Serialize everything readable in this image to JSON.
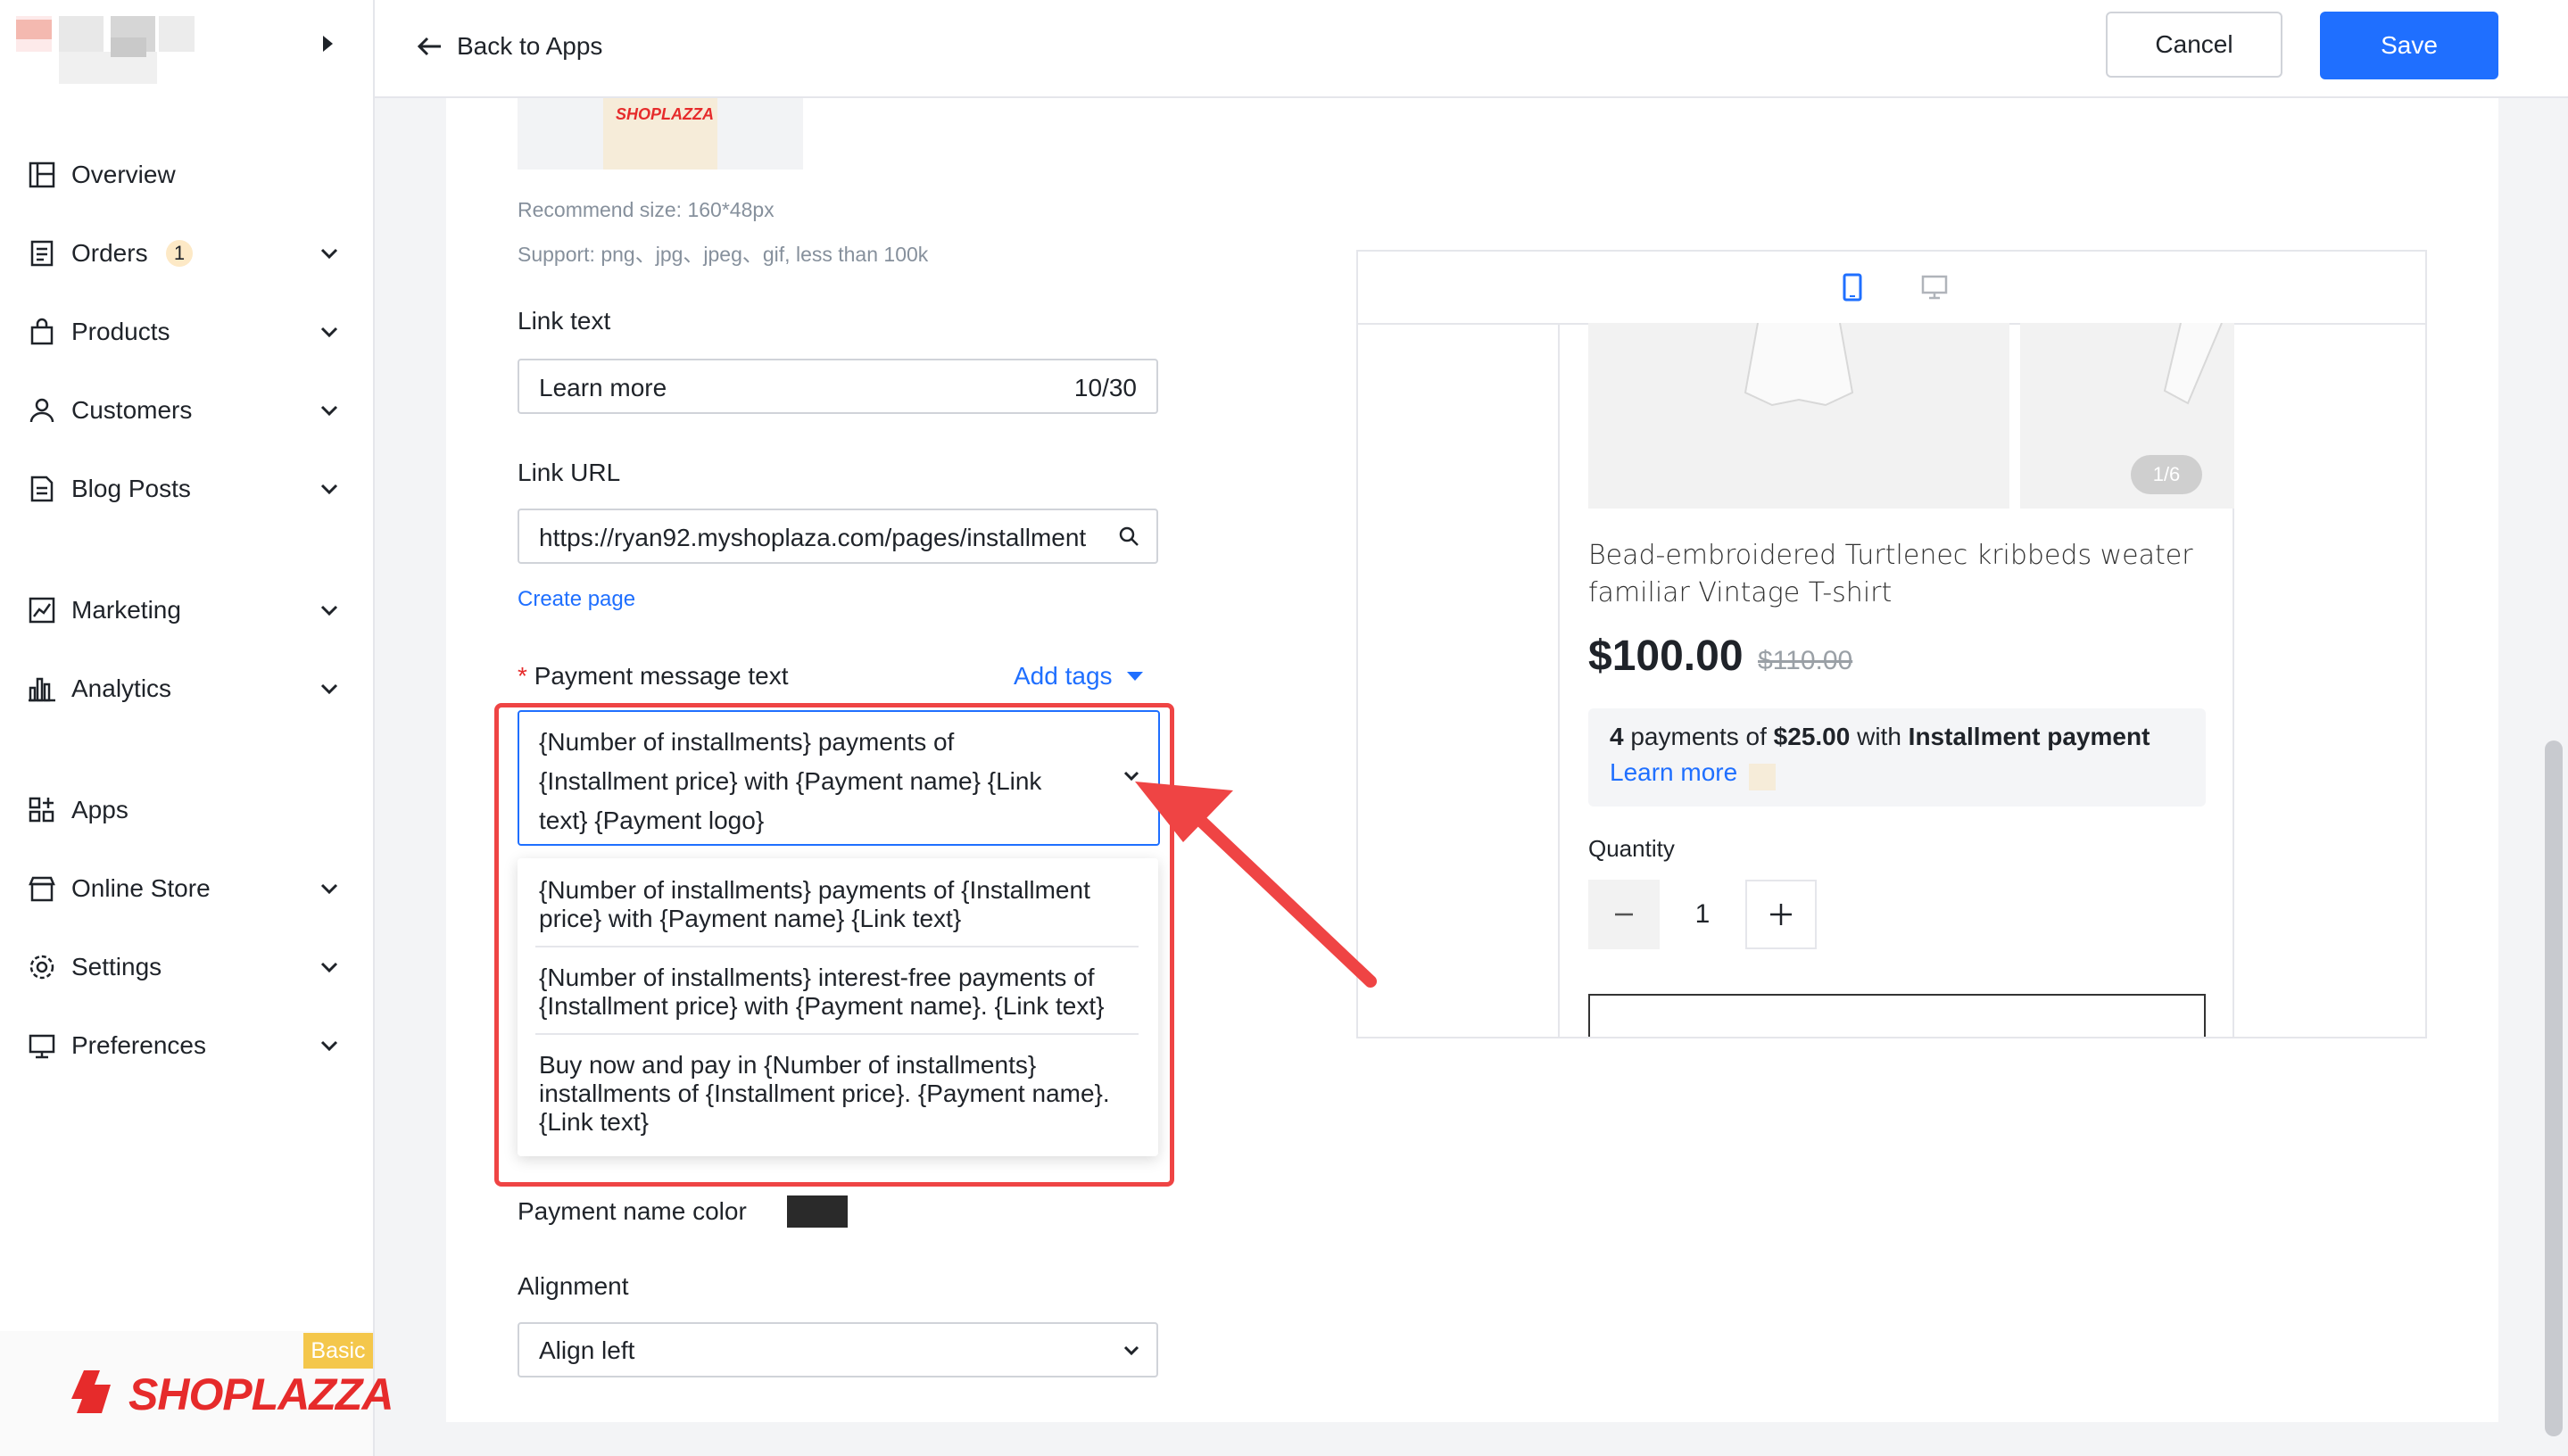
{
  "sidebar": {
    "nav": [
      {
        "label": "Overview",
        "icon": "overview-icon"
      },
      {
        "label": "Orders",
        "icon": "orders-icon",
        "badge": "1"
      },
      {
        "label": "Products",
        "icon": "products-icon"
      },
      {
        "label": "Customers",
        "icon": "customers-icon"
      },
      {
        "label": "Blog Posts",
        "icon": "blog-posts-icon"
      },
      {
        "label": "Marketing",
        "icon": "marketing-icon"
      },
      {
        "label": "Analytics",
        "icon": "analytics-icon"
      },
      {
        "label": "Apps",
        "icon": "apps-icon"
      },
      {
        "label": "Online Store",
        "icon": "online-store-icon"
      },
      {
        "label": "Settings",
        "icon": "settings-icon"
      },
      {
        "label": "Preferences",
        "icon": "preferences-icon"
      }
    ],
    "plan_badge": "Basic",
    "brand": "SHOPLAZZA"
  },
  "header": {
    "back_label": "Back to Apps",
    "cancel_label": "Cancel",
    "save_label": "Save"
  },
  "form": {
    "logo_preview_text": "SHOPLAZZA",
    "recommend_size": "Recommend size: 160*48px",
    "support": "Support: png、jpg、jpeg、gif, less than 100k",
    "link_text_label": "Link text",
    "link_text_value": "Learn more",
    "link_text_count": "10/30",
    "link_url_label": "Link URL",
    "link_url_value": "https://ryan92.myshoplaza.com/pages/installment",
    "create_page": "Create page",
    "payment_message_required": "*",
    "payment_message_label": "Payment message text",
    "add_tags": "Add tags",
    "payment_message_value": "{Number of installments} payments of {Installment price} with {Payment name} {Link text} {Payment logo}",
    "options": [
      "{Number of installments} payments of {Installment price} with {Payment name} {Link text}",
      "{Number of installments} interest-free payments of {Installment price} with {Payment name}. {Link text}",
      "Buy now and pay in {Number of installments} installments of {Installment price}. {Payment name}. {Link text}"
    ],
    "payment_name_color_label": "Payment name color",
    "payment_name_color": "#2a2a2a",
    "alignment_label": "Alignment",
    "alignment_value": "Align left"
  },
  "preview": {
    "image_counter": "1/6",
    "product_title": "Bead-embroidered Turtlenec kribbeds weater familiar Vintage T-shirt",
    "price": "$100.00",
    "compare_price": "$110.00",
    "installment": {
      "count": "4",
      "text_payments_of": "payments of",
      "amount": "$25.00",
      "text_with": "with",
      "payment_name": "Installment payment",
      "learn_more": "Learn more"
    },
    "quantity_label": "Quantity",
    "quantity_value": "1"
  },
  "colors": {
    "accent": "#1f6fff",
    "highlight": "#ef4444",
    "brand_red": "#e62b2b",
    "plan_badge": "#f4c74b"
  }
}
